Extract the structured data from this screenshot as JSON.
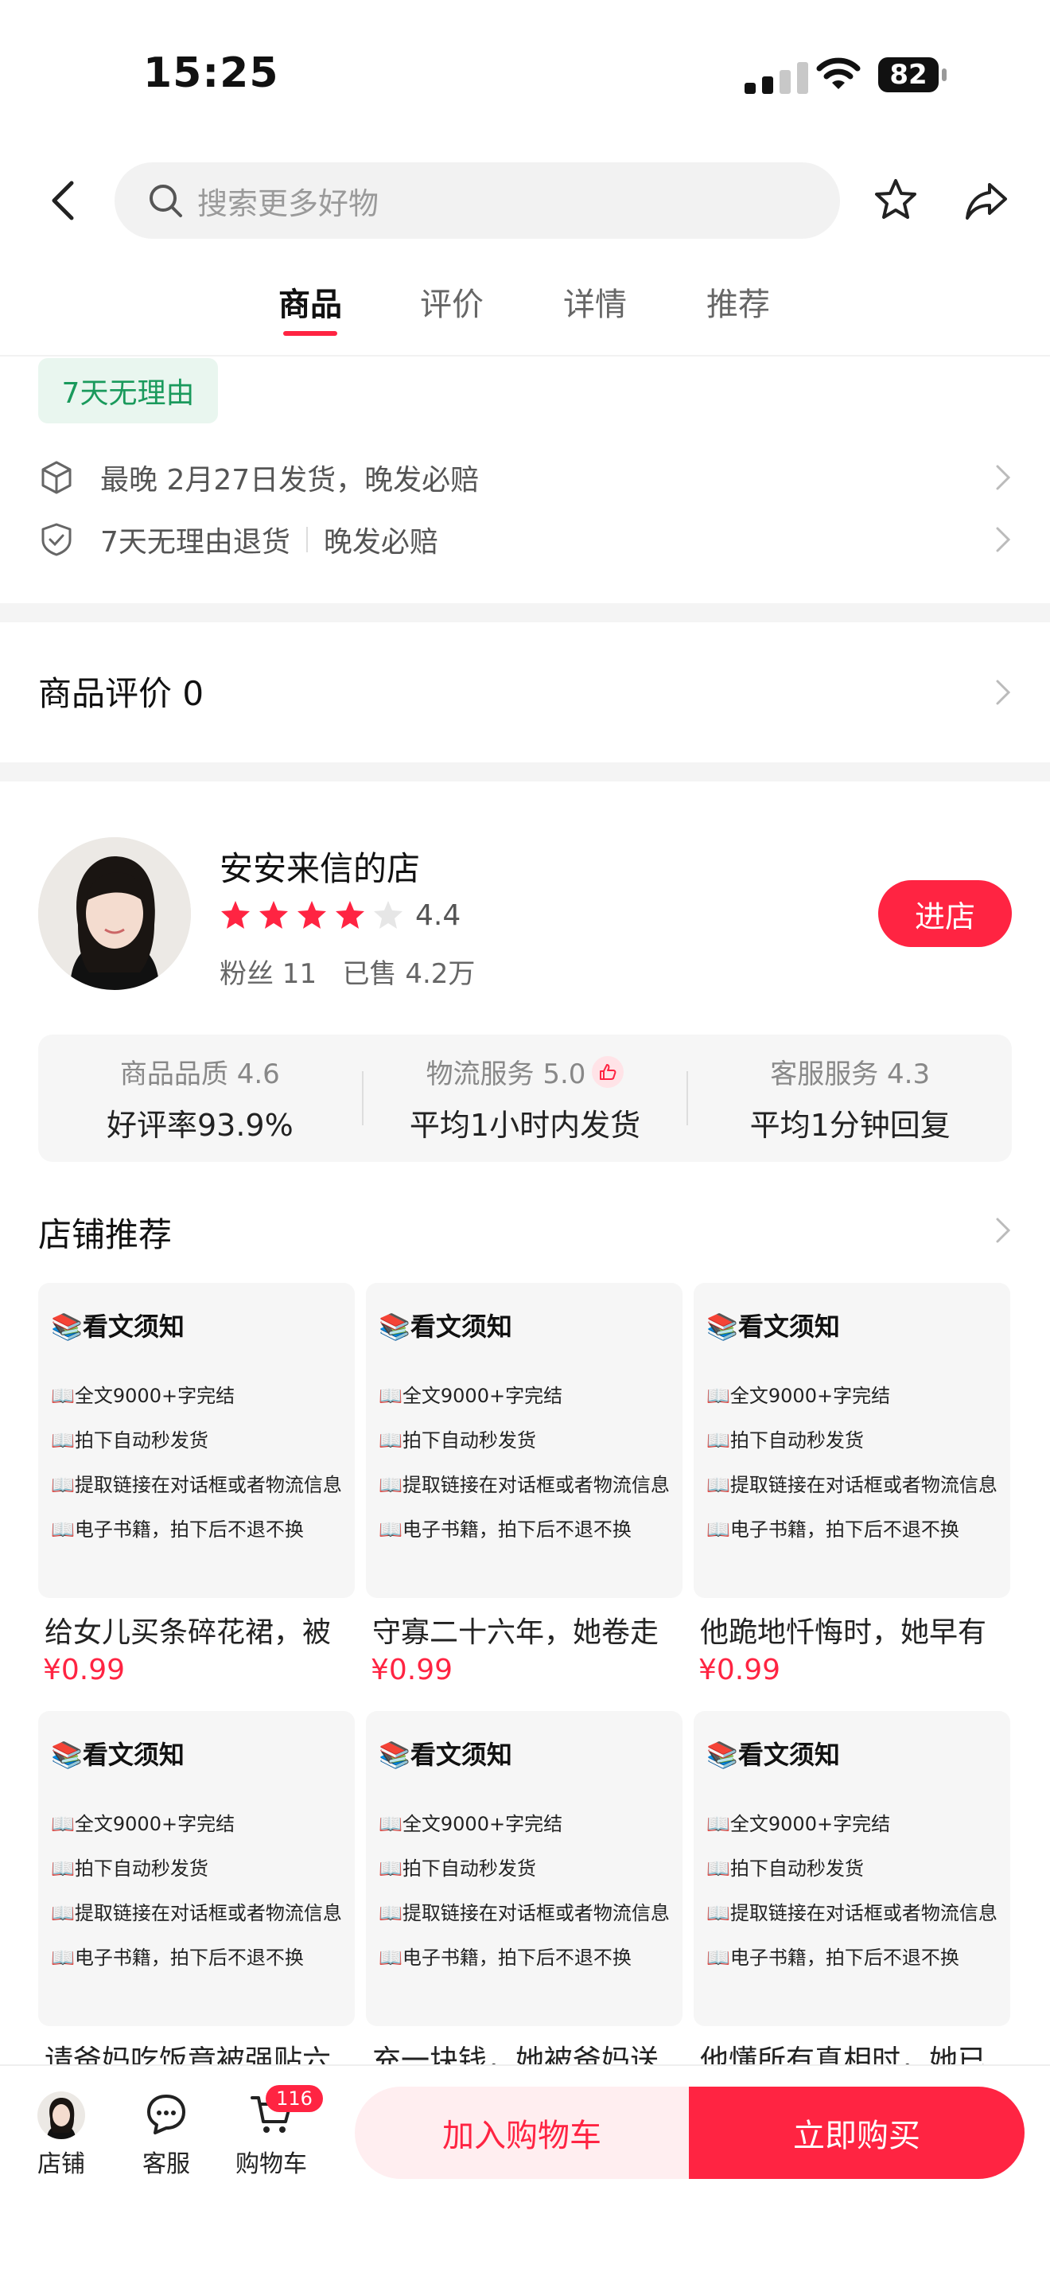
{
  "status_bar": {
    "time": "15:25",
    "battery": "82"
  },
  "header": {
    "search_placeholder": "搜索更多好物"
  },
  "tabs": [
    {
      "label": "商品"
    },
    {
      "label": "评价"
    },
    {
      "label": "详情"
    },
    {
      "label": "推荐"
    }
  ],
  "service": {
    "badge": "7天无理由",
    "shipping": "最晚 2月27日发货，晚发必赔",
    "returns": "7天无理由退货",
    "returns_extra": "晚发必赔"
  },
  "reviews": {
    "title": "商品评价 0"
  },
  "shop": {
    "name": "安安来信的店",
    "rating": "4.4",
    "rating_value": 4.4,
    "fans": "粉丝 11",
    "sold": "已售 4.2万",
    "enter_label": "进店",
    "scores": [
      {
        "label": "商品品质 4.6",
        "detail": "好评率93.9%"
      },
      {
        "label": "物流服务 5.0",
        "detail": "平均1小时内发货"
      },
      {
        "label": "客服服务 4.3",
        "detail": "平均1分钟回复"
      }
    ]
  },
  "recommend": {
    "title": "店铺推荐",
    "card_heading": "📚看文须知",
    "card_lines": [
      "📖全文9000+字完结",
      "📖拍下自动秒发货",
      "📖提取链接在对话框或者物流信息",
      "📖电子书籍，拍下后不退不换"
    ],
    "items": [
      {
        "title": "给女儿买条碎花裙，被",
        "price": "¥0.99"
      },
      {
        "title": "守寡二十六年，她卷走",
        "price": "¥0.99"
      },
      {
        "title": "他跪地忏悔时，她早有",
        "price": "¥0.99"
      },
      {
        "title": "请爸妈吃饭竟被强贴六",
        "price": ""
      },
      {
        "title": "充一块钱，她被爸妈送",
        "price": ""
      },
      {
        "title": "他懂所有真相时，她已",
        "price": ""
      }
    ]
  },
  "bottom_bar": {
    "shop_label": "店铺",
    "service_label": "客服",
    "cart_label": "购物车",
    "cart_count": "116",
    "add_to_cart": "加入购物车",
    "buy_now": "立即购买"
  },
  "colors": {
    "accent": "#ff2442",
    "green": "#1a9a5c"
  }
}
